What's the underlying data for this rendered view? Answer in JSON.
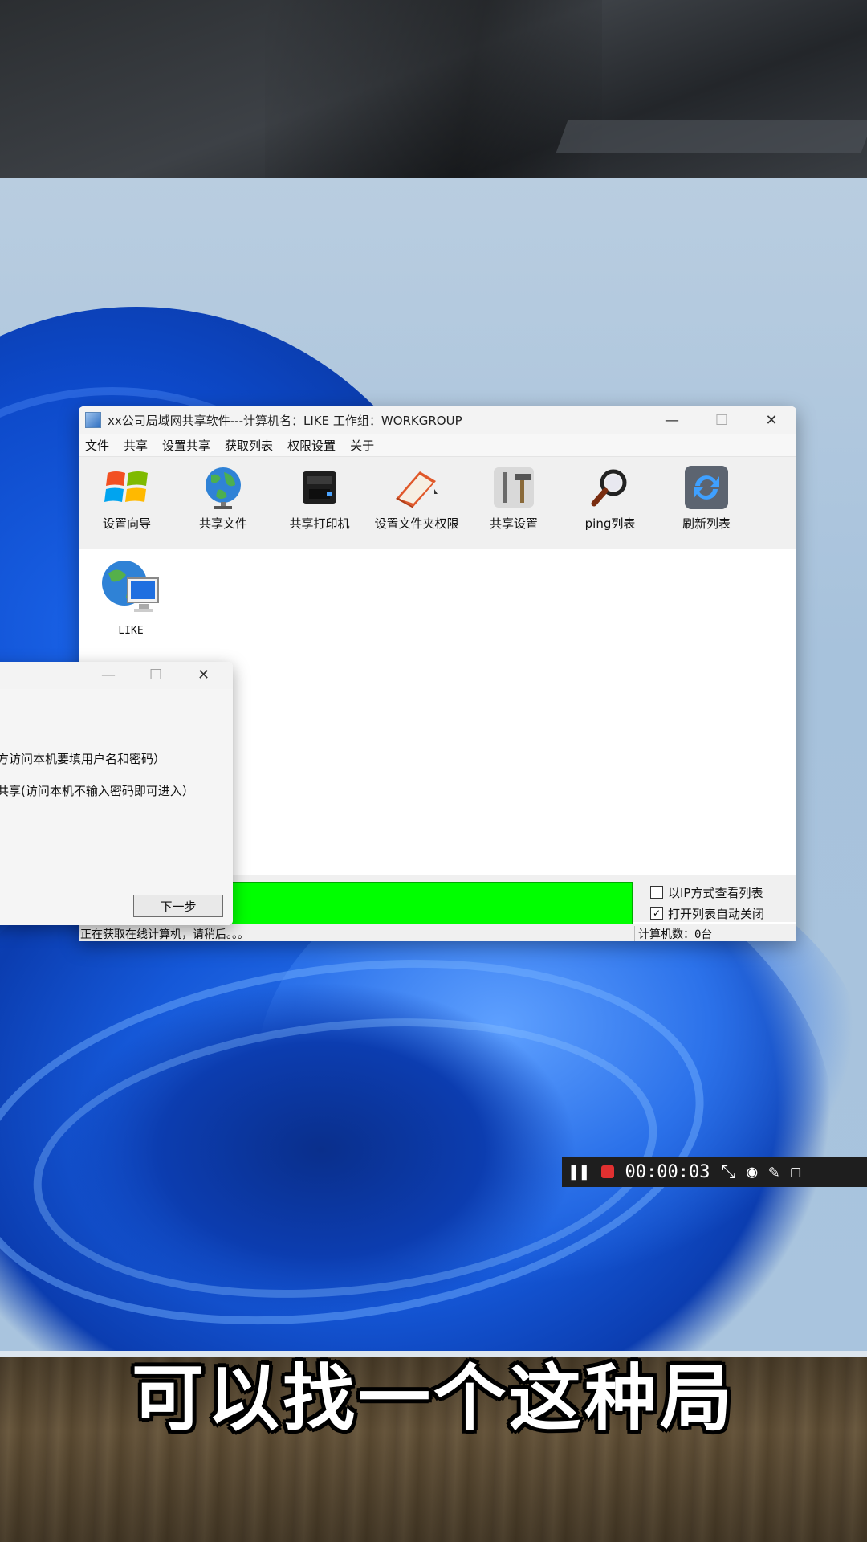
{
  "app": {
    "title": "xx公司局域网共享软件---计算机名：LIKE  工作组：WORKGROUP",
    "controls": {
      "minimize": "—",
      "maximize": "☐",
      "close": "✕"
    },
    "menu": [
      "文件",
      "共享",
      "设置共享",
      "获取列表",
      "权限设置",
      "关于"
    ],
    "toolbar": [
      {
        "label": "设置向导",
        "icon": "windows-logo-icon"
      },
      {
        "label": "共享文件",
        "icon": "globe-icon"
      },
      {
        "label": "共享打印机",
        "icon": "printer-icon"
      },
      {
        "label": "设置文件夹权限",
        "icon": "folder-book-icon"
      },
      {
        "label": "共享设置",
        "icon": "tools-icon"
      },
      {
        "label": "ping列表",
        "icon": "magnifier-icon"
      },
      {
        "label": "刷新列表",
        "icon": "refresh-icon"
      }
    ],
    "computers": [
      {
        "name": "LIKE",
        "icon": "networked-computer-icon"
      }
    ],
    "options": [
      {
        "label": "以IP方式查看列表",
        "checked": false
      },
      {
        "label": "打开列表自动关闭",
        "checked": true
      }
    ],
    "progress_color": "#00ff00",
    "status": {
      "message": "正在获取在线计算机，请稍后。。。",
      "count": "计算机数：0台"
    }
  },
  "wizard": {
    "lines": [
      ":",
      "方访问本机要填用户名和密码）",
      "共享(访问本机不输入密码即可进入）"
    ],
    "next_button": "下一步"
  },
  "recorder": {
    "timer": "00:00:03",
    "icons": [
      "pause-icon",
      "stop-icon",
      "shrink-icon",
      "camera-icon",
      "pen-icon",
      "window-icon"
    ]
  },
  "subtitle": "可以找一个这种局"
}
